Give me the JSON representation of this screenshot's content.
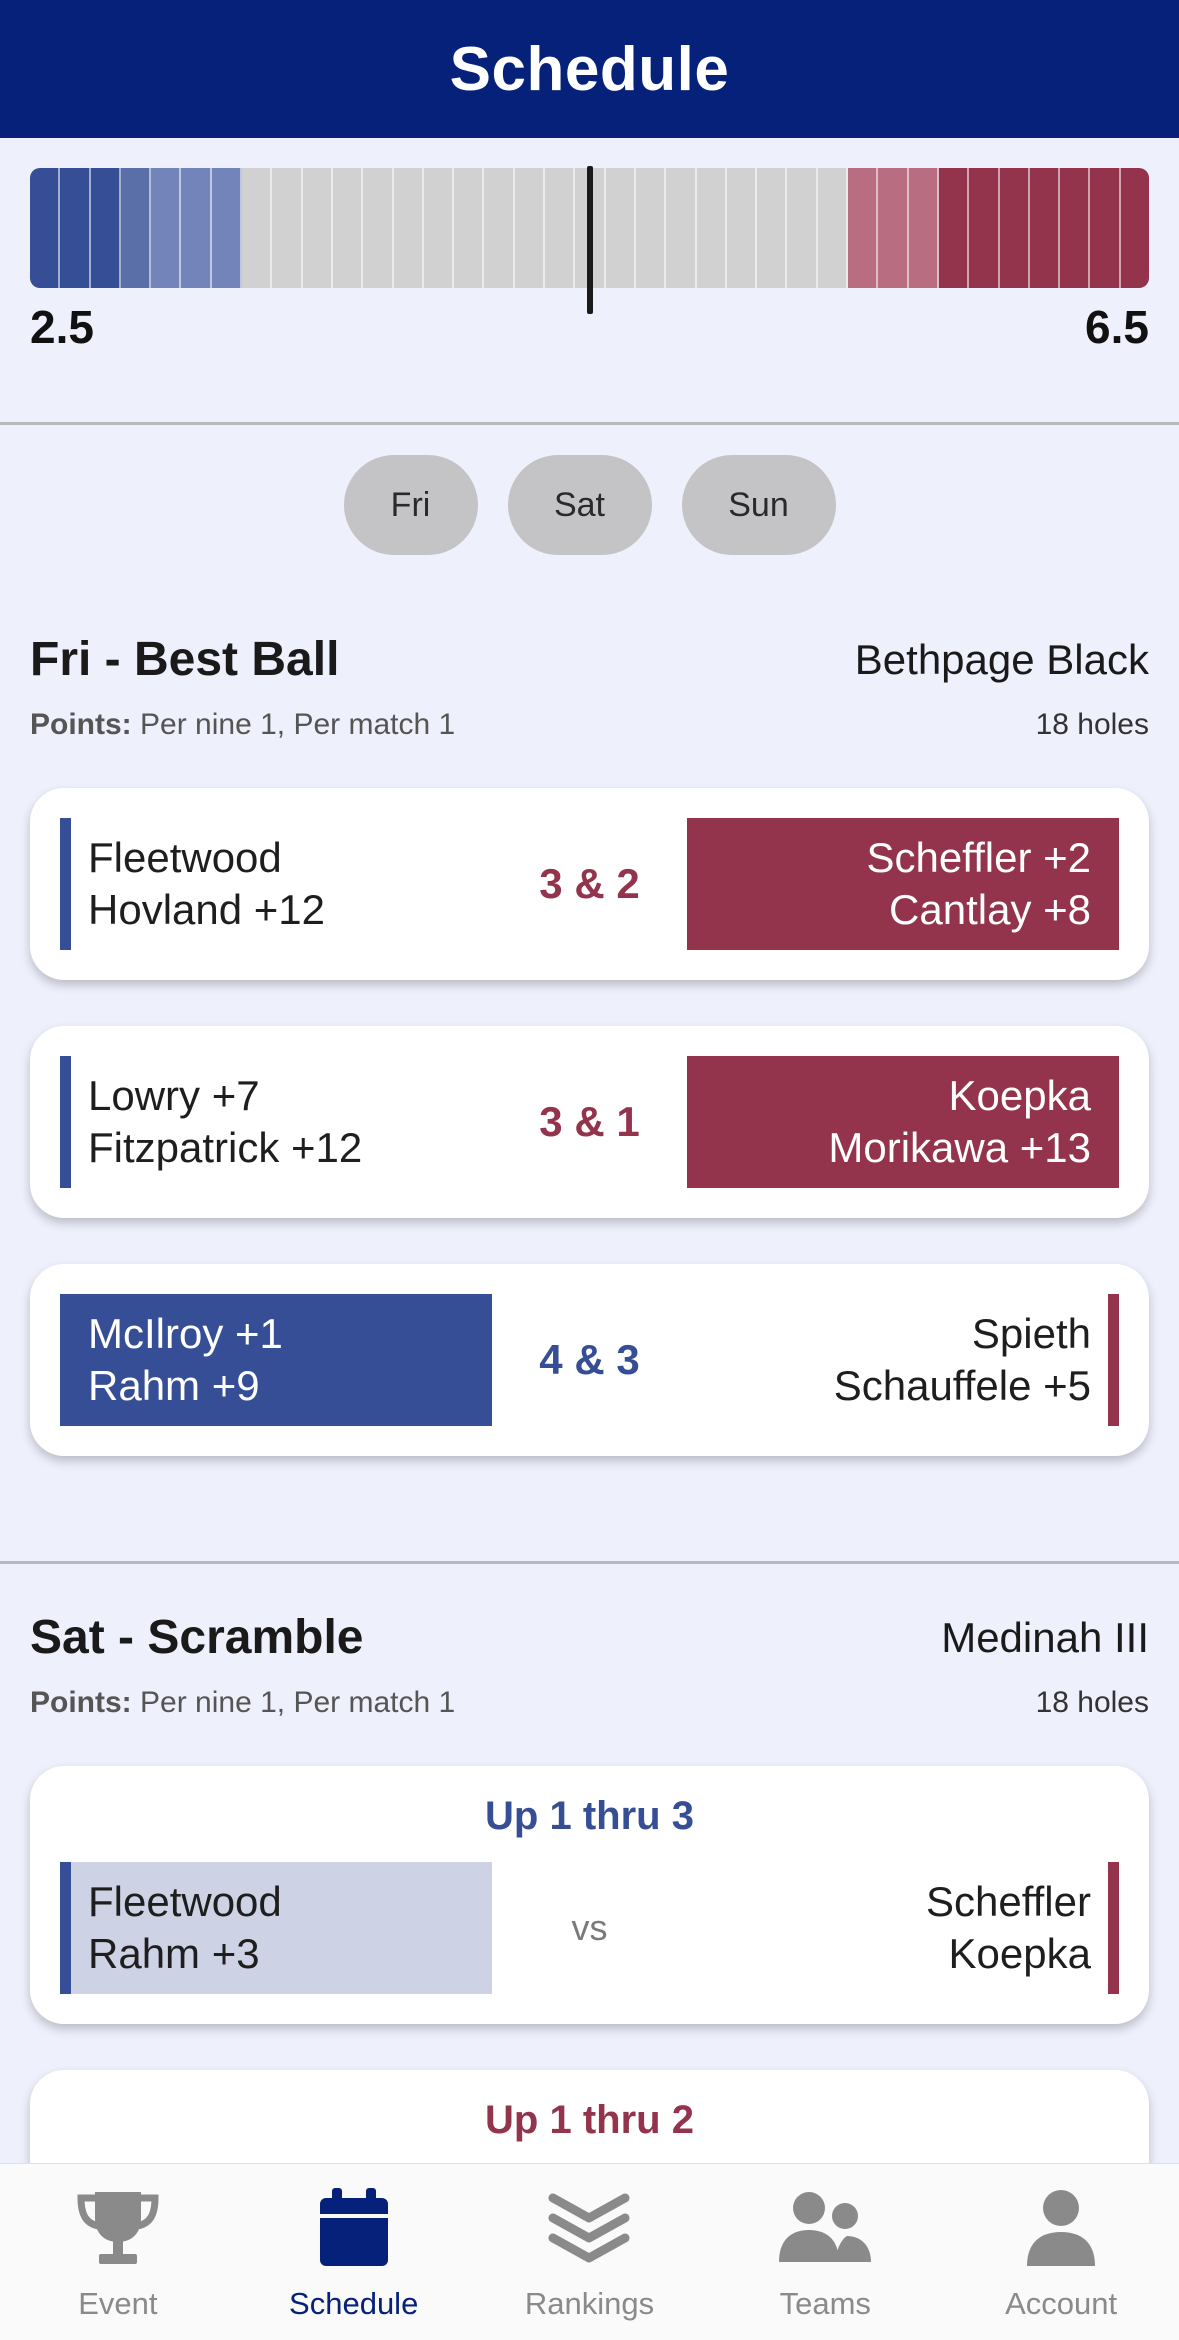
{
  "header": {
    "title": "Schedule"
  },
  "score": {
    "left": "2.5",
    "right": "6.5",
    "segments": [
      "#354e95",
      "#354e95",
      "#354e95",
      "#5a6ea8",
      "#7384bb",
      "#7384bb",
      "#7384bb",
      "#d1d1d1",
      "#d1d1d1",
      "#d1d1d1",
      "#d1d1d1",
      "#d1d1d1",
      "#d1d1d1",
      "#d1d1d1",
      "#d1d1d1",
      "#d1d1d1",
      "#d1d1d1",
      "#d1d1d1",
      "#d1d1d1",
      "#d1d1d1",
      "#d1d1d1",
      "#d1d1d1",
      "#d1d1d1",
      "#d1d1d1",
      "#d1d1d1",
      "#d1d1d1",
      "#d1d1d1",
      "#b86d81",
      "#b86d81",
      "#b86d81",
      "#93334c",
      "#93334c",
      "#93334c",
      "#93334c",
      "#93334c",
      "#93334c",
      "#93334c"
    ]
  },
  "days": [
    "Fri",
    "Sat",
    "Sun"
  ],
  "sections": [
    {
      "title": "Fri - Best Ball",
      "course": "Bethpage Black",
      "points_label": "Points:",
      "points_value": "Per nine 1, Per match 1",
      "holes": "18 holes",
      "matches": [
        {
          "left": [
            "Fleetwood",
            "Hovland +12"
          ],
          "right": [
            "Scheffler +2",
            "Cantlay +8"
          ],
          "result": "3 & 2"
        },
        {
          "left": [
            "Lowry +7",
            "Fitzpatrick +12"
          ],
          "right": [
            "Koepka",
            "Morikawa +13"
          ],
          "result": "3 & 1"
        },
        {
          "left": [
            "McIlroy +1",
            "Rahm +9"
          ],
          "right": [
            "Spieth",
            "Schauffele +5"
          ],
          "result": "4 & 3"
        }
      ]
    },
    {
      "title": "Sat - Scramble",
      "course": "Medinah III",
      "points_label": "Points:",
      "points_value": "Per nine 1, Per match 1",
      "holes": "18 holes",
      "matches": [
        {
          "status": "Up 1 thru 3",
          "left": [
            "Fleetwood",
            "Rahm  +3"
          ],
          "right": [
            "Scheffler",
            "Koepka"
          ],
          "result": "vs"
        },
        {
          "status": "Up 1 thru 2"
        }
      ]
    }
  ],
  "nav": [
    {
      "label": "Event",
      "icon": "trophy-icon"
    },
    {
      "label": "Schedule",
      "icon": "calendar-icon",
      "active": true
    },
    {
      "label": "Rankings",
      "icon": "layers-icon"
    },
    {
      "label": "Teams",
      "icon": "users-icon"
    },
    {
      "label": "Account",
      "icon": "user-icon"
    }
  ],
  "colors": {
    "header": "#05217a",
    "blue": "#354e95",
    "red": "#93334c",
    "lead_blue": "#cdd2e4"
  }
}
